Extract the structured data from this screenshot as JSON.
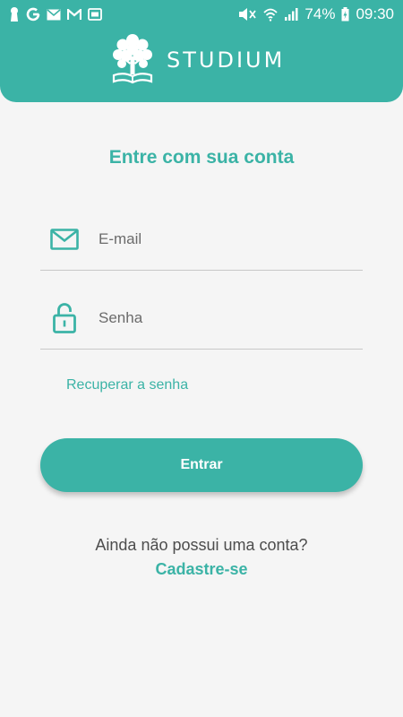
{
  "status_bar": {
    "battery": "74%",
    "time": "09:30",
    "left_icons": [
      "keyhole-icon",
      "google-icon",
      "mail-icon",
      "gmail-icon",
      "photo-icon"
    ],
    "right_icons": [
      "mute-icon",
      "wifi-icon",
      "signal-icon",
      "battery-icon"
    ]
  },
  "header": {
    "brand": "STUDIUM",
    "logo_icon": "tree-book-icon"
  },
  "login": {
    "title": "Entre com sua conta",
    "email_placeholder": "E-mail",
    "email_value": "",
    "email_icon": "mail-icon",
    "password_placeholder": "Senha",
    "password_value": "",
    "password_icon": "lock-icon",
    "recover_label": "Recuperar a senha",
    "submit_label": "Entrar"
  },
  "signup": {
    "question": "Ainda não possui uma conta?",
    "link_label": "Cadastre-se"
  },
  "colors": {
    "primary": "#3bb3a6",
    "background": "#f5f5f5",
    "text": "#4d4d4d"
  }
}
